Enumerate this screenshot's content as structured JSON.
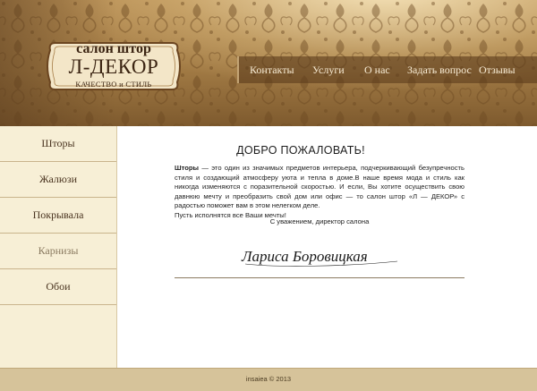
{
  "brand": {
    "top": "салон штор",
    "name": "Л-ДЕКОР",
    "tagline": "КАЧЕСТВО и СТИЛЬ"
  },
  "nav": {
    "items": [
      {
        "label": "Контакты"
      },
      {
        "label": "Услуги"
      },
      {
        "label": "О нас"
      },
      {
        "label": "Задать вопрос"
      },
      {
        "label": "Отзывы"
      }
    ]
  },
  "sidebar": {
    "items": [
      {
        "label": "Шторы"
      },
      {
        "label": "Жалюзи"
      },
      {
        "label": "Покрывала"
      },
      {
        "label": "Карнизы"
      },
      {
        "label": "Обои"
      }
    ]
  },
  "main": {
    "title": "ДОБРО ПОЖАЛОВАТЬ!",
    "intro_bold": "Шторы",
    "intro_text": " — это один из значимых предметов интерьера, подчеркивающий безупречность стиля и создающий атмосферу уюта и тепла в доме.В наше время мода и стиль как никогда изменяются с поразительной скоростью. И если, Вы хотите осуществить свою давнюю мечту и преобразить свой дом или офис — то салон штор «Л — ДЕКОР» с радостью поможет вам в этом нелегком деле.",
    "wish": "Пусть исполнятся все Ваши мечты!",
    "regards": "С уважением, директор салона",
    "signature": "Лариса Боровицкая"
  },
  "footer": {
    "copyright": "insaiea © 2013"
  },
  "colors": {
    "header_brown": "#a17a44",
    "nav_bg": "#5c3c1c",
    "sidebar_bg": "#f7efd6",
    "footer_bg": "#d6c39a"
  }
}
